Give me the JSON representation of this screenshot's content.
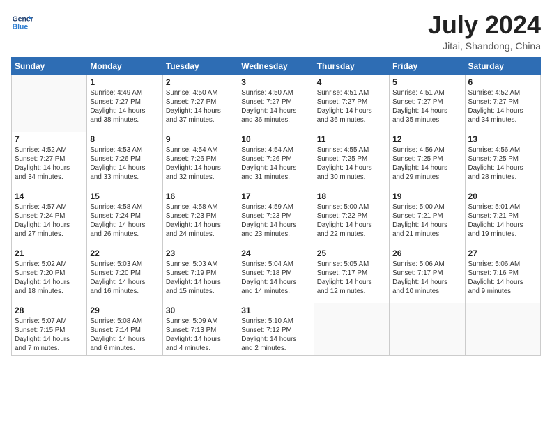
{
  "header": {
    "logo_line1": "General",
    "logo_line2": "Blue",
    "month": "July 2024",
    "location": "Jitai, Shandong, China"
  },
  "weekdays": [
    "Sunday",
    "Monday",
    "Tuesday",
    "Wednesday",
    "Thursday",
    "Friday",
    "Saturday"
  ],
  "weeks": [
    [
      {
        "day": "",
        "info": ""
      },
      {
        "day": "1",
        "info": "Sunrise: 4:49 AM\nSunset: 7:27 PM\nDaylight: 14 hours\nand 38 minutes."
      },
      {
        "day": "2",
        "info": "Sunrise: 4:50 AM\nSunset: 7:27 PM\nDaylight: 14 hours\nand 37 minutes."
      },
      {
        "day": "3",
        "info": "Sunrise: 4:50 AM\nSunset: 7:27 PM\nDaylight: 14 hours\nand 36 minutes."
      },
      {
        "day": "4",
        "info": "Sunrise: 4:51 AM\nSunset: 7:27 PM\nDaylight: 14 hours\nand 36 minutes."
      },
      {
        "day": "5",
        "info": "Sunrise: 4:51 AM\nSunset: 7:27 PM\nDaylight: 14 hours\nand 35 minutes."
      },
      {
        "day": "6",
        "info": "Sunrise: 4:52 AM\nSunset: 7:27 PM\nDaylight: 14 hours\nand 34 minutes."
      }
    ],
    [
      {
        "day": "7",
        "info": "Sunrise: 4:52 AM\nSunset: 7:27 PM\nDaylight: 14 hours\nand 34 minutes."
      },
      {
        "day": "8",
        "info": "Sunrise: 4:53 AM\nSunset: 7:26 PM\nDaylight: 14 hours\nand 33 minutes."
      },
      {
        "day": "9",
        "info": "Sunrise: 4:54 AM\nSunset: 7:26 PM\nDaylight: 14 hours\nand 32 minutes."
      },
      {
        "day": "10",
        "info": "Sunrise: 4:54 AM\nSunset: 7:26 PM\nDaylight: 14 hours\nand 31 minutes."
      },
      {
        "day": "11",
        "info": "Sunrise: 4:55 AM\nSunset: 7:25 PM\nDaylight: 14 hours\nand 30 minutes."
      },
      {
        "day": "12",
        "info": "Sunrise: 4:56 AM\nSunset: 7:25 PM\nDaylight: 14 hours\nand 29 minutes."
      },
      {
        "day": "13",
        "info": "Sunrise: 4:56 AM\nSunset: 7:25 PM\nDaylight: 14 hours\nand 28 minutes."
      }
    ],
    [
      {
        "day": "14",
        "info": "Sunrise: 4:57 AM\nSunset: 7:24 PM\nDaylight: 14 hours\nand 27 minutes."
      },
      {
        "day": "15",
        "info": "Sunrise: 4:58 AM\nSunset: 7:24 PM\nDaylight: 14 hours\nand 26 minutes."
      },
      {
        "day": "16",
        "info": "Sunrise: 4:58 AM\nSunset: 7:23 PM\nDaylight: 14 hours\nand 24 minutes."
      },
      {
        "day": "17",
        "info": "Sunrise: 4:59 AM\nSunset: 7:23 PM\nDaylight: 14 hours\nand 23 minutes."
      },
      {
        "day": "18",
        "info": "Sunrise: 5:00 AM\nSunset: 7:22 PM\nDaylight: 14 hours\nand 22 minutes."
      },
      {
        "day": "19",
        "info": "Sunrise: 5:00 AM\nSunset: 7:21 PM\nDaylight: 14 hours\nand 21 minutes."
      },
      {
        "day": "20",
        "info": "Sunrise: 5:01 AM\nSunset: 7:21 PM\nDaylight: 14 hours\nand 19 minutes."
      }
    ],
    [
      {
        "day": "21",
        "info": "Sunrise: 5:02 AM\nSunset: 7:20 PM\nDaylight: 14 hours\nand 18 minutes."
      },
      {
        "day": "22",
        "info": "Sunrise: 5:03 AM\nSunset: 7:20 PM\nDaylight: 14 hours\nand 16 minutes."
      },
      {
        "day": "23",
        "info": "Sunrise: 5:03 AM\nSunset: 7:19 PM\nDaylight: 14 hours\nand 15 minutes."
      },
      {
        "day": "24",
        "info": "Sunrise: 5:04 AM\nSunset: 7:18 PM\nDaylight: 14 hours\nand 14 minutes."
      },
      {
        "day": "25",
        "info": "Sunrise: 5:05 AM\nSunset: 7:17 PM\nDaylight: 14 hours\nand 12 minutes."
      },
      {
        "day": "26",
        "info": "Sunrise: 5:06 AM\nSunset: 7:17 PM\nDaylight: 14 hours\nand 10 minutes."
      },
      {
        "day": "27",
        "info": "Sunrise: 5:06 AM\nSunset: 7:16 PM\nDaylight: 14 hours\nand 9 minutes."
      }
    ],
    [
      {
        "day": "28",
        "info": "Sunrise: 5:07 AM\nSunset: 7:15 PM\nDaylight: 14 hours\nand 7 minutes."
      },
      {
        "day": "29",
        "info": "Sunrise: 5:08 AM\nSunset: 7:14 PM\nDaylight: 14 hours\nand 6 minutes."
      },
      {
        "day": "30",
        "info": "Sunrise: 5:09 AM\nSunset: 7:13 PM\nDaylight: 14 hours\nand 4 minutes."
      },
      {
        "day": "31",
        "info": "Sunrise: 5:10 AM\nSunset: 7:12 PM\nDaylight: 14 hours\nand 2 minutes."
      },
      {
        "day": "",
        "info": ""
      },
      {
        "day": "",
        "info": ""
      },
      {
        "day": "",
        "info": ""
      }
    ]
  ]
}
